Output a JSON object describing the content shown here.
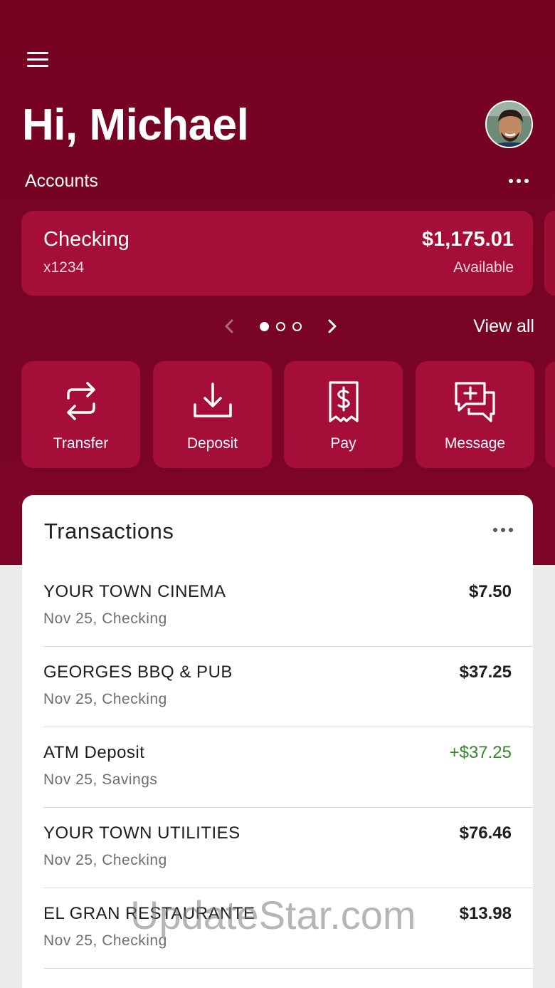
{
  "greeting": "Hi, Michael",
  "accounts": {
    "label": "Accounts",
    "card": {
      "name": "Checking",
      "number": "x1234",
      "balance": "$1,175.01",
      "balance_label": "Available"
    },
    "pager": {
      "pages": 3,
      "active_index": 0
    },
    "view_all": "View all"
  },
  "actions": [
    {
      "label": "Transfer",
      "icon": "transfer-icon"
    },
    {
      "label": "Deposit",
      "icon": "deposit-icon"
    },
    {
      "label": "Pay",
      "icon": "pay-bill-icon"
    },
    {
      "label": "Message",
      "icon": "message-icon"
    }
  ],
  "transactions": {
    "title": "Transactions",
    "items": [
      {
        "name": "YOUR TOWN CINEMA",
        "sub": "Nov 25, Checking",
        "amount": "$7.50",
        "credit": false
      },
      {
        "name": "GEORGES BBQ & PUB",
        "sub": "Nov 25, Checking",
        "amount": "$37.25",
        "credit": false
      },
      {
        "name": "ATM Deposit",
        "sub": "Nov 25, Savings",
        "amount": "+$37.25",
        "credit": true
      },
      {
        "name": "YOUR TOWN UTILITIES",
        "sub": "Nov 25, Checking",
        "amount": "$76.46",
        "credit": false
      },
      {
        "name": "EL GRAN RESTAURANTE",
        "sub": "Nov 25, Checking",
        "amount": "$13.98",
        "credit": false
      }
    ]
  },
  "colors": {
    "brand": "#740322",
    "card": "#a40e38",
    "credit": "#35862a"
  },
  "watermark": "UpdateStar.com"
}
